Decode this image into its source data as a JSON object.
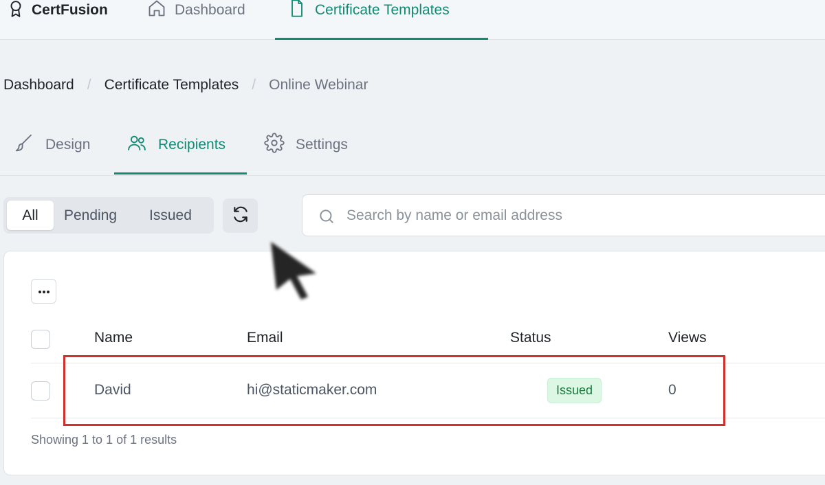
{
  "topbar": {
    "brand": "CertFusion",
    "nav": [
      {
        "label": "Dashboard",
        "icon": "home-icon"
      },
      {
        "label": "Certificate Templates",
        "icon": "file-icon",
        "active": true
      }
    ]
  },
  "breadcrumb": [
    "Dashboard",
    "Certificate Templates",
    "Online Webinar"
  ],
  "tabs": [
    {
      "label": "Design",
      "icon": "brush-icon"
    },
    {
      "label": "Recipients",
      "icon": "users-icon",
      "active": true
    },
    {
      "label": "Settings",
      "icon": "gear-icon"
    }
  ],
  "filters": {
    "options": [
      "All",
      "Pending",
      "Issued"
    ],
    "selected": "All"
  },
  "search": {
    "placeholder": "Search by name or email address",
    "value": ""
  },
  "table": {
    "columns": [
      "Name",
      "Email",
      "Status",
      "Views"
    ],
    "rows": [
      {
        "name": "David",
        "email": "hi@staticmaker.com",
        "status": "Issued",
        "views": "0"
      }
    ],
    "footer": "Showing 1 to 1 of 1 results"
  },
  "colors": {
    "accent": "#138a73",
    "status_issued_bg": "#dcf7e4",
    "status_issued_text": "#1a7a3c",
    "highlight": "#d0312d"
  }
}
